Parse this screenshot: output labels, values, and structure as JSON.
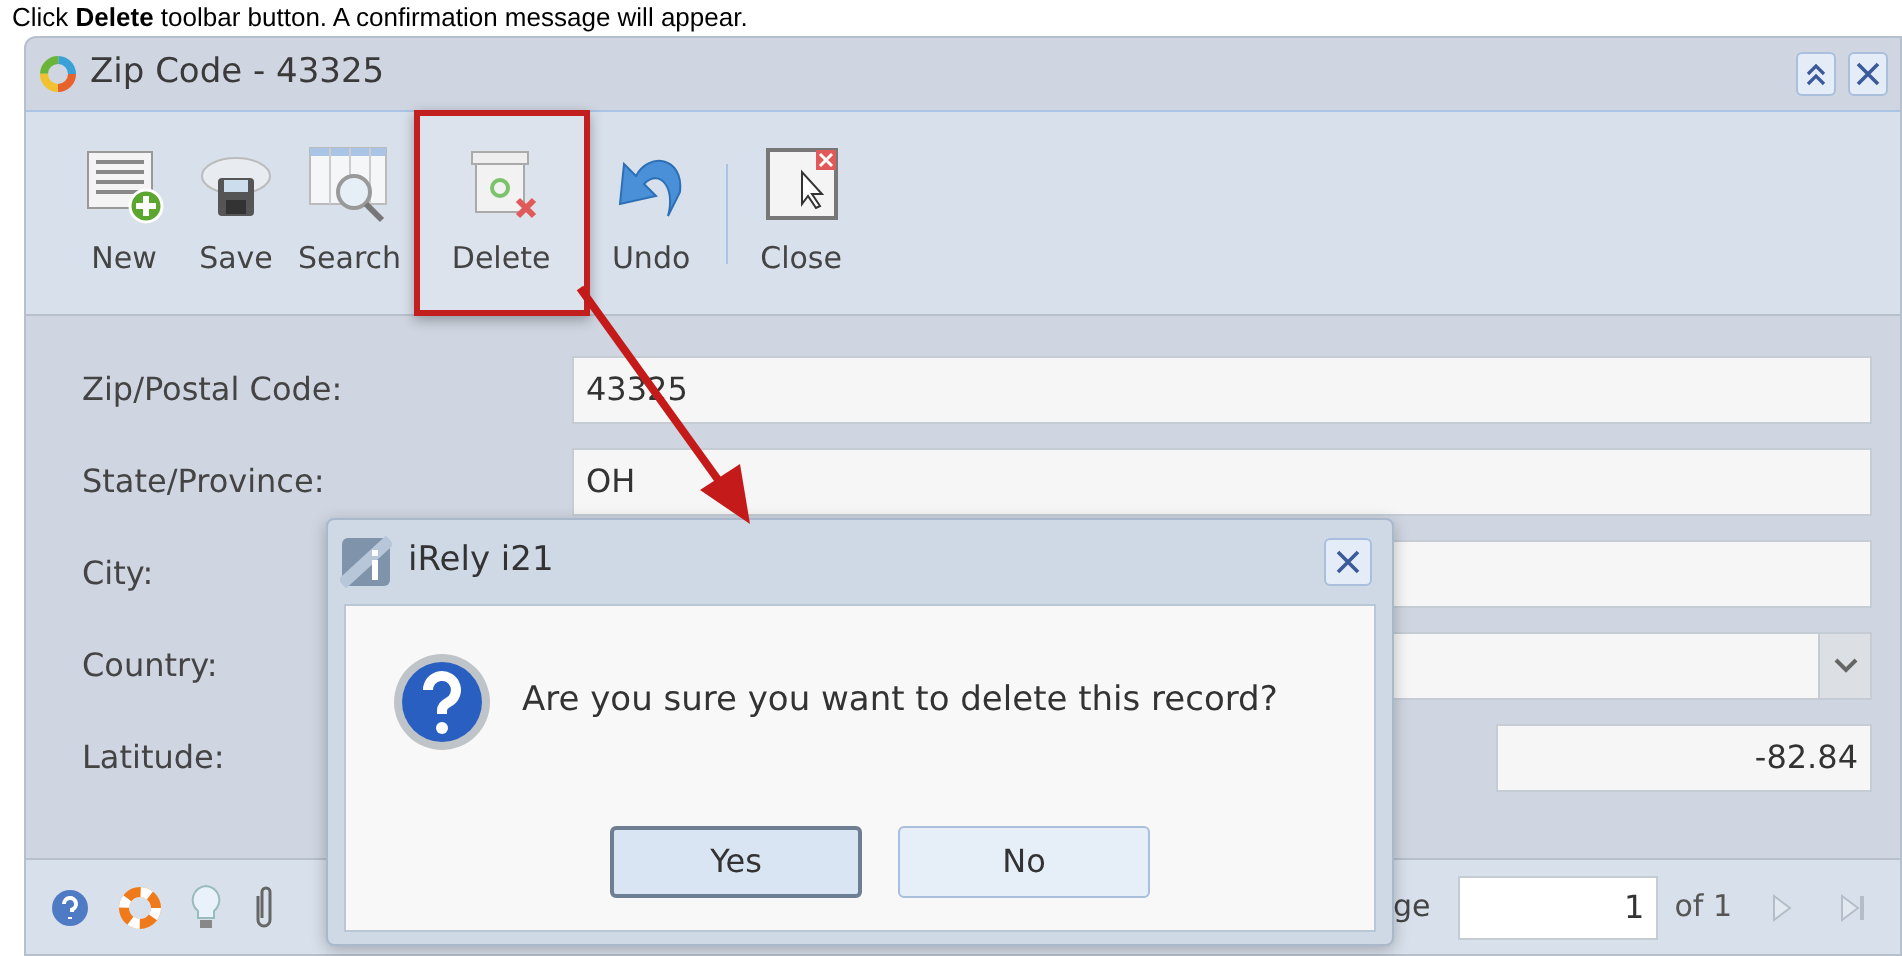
{
  "caption": "Click **Delete** toolbar button. A confirmation message will appear.",
  "window": {
    "title": "Zip Code - 43325"
  },
  "toolbar": [
    {
      "label": "New",
      "kind": "new",
      "highlighted": false
    },
    {
      "label": "Save",
      "kind": "save",
      "highlighted": false
    },
    {
      "label": "Search",
      "kind": "search",
      "highlighted": false
    },
    {
      "label": "Delete",
      "kind": "delete",
      "highlighted": true
    },
    {
      "label": "Undo",
      "kind": "undo",
      "highlighted": false
    },
    {
      "label": "Close",
      "kind": "close",
      "highlighted": false
    }
  ],
  "form": [
    {
      "label": "Zip/Postal Code:",
      "value": "43325",
      "kind": "text"
    },
    {
      "label": "State/Province:",
      "value": "OH",
      "kind": "text"
    },
    {
      "label": "City:",
      "kind": "text"
    },
    {
      "label": "Country:",
      "kind": "combo"
    },
    {
      "label": "Latitude:",
      "value": "-82.84",
      "kind": "number"
    }
  ],
  "paging": {
    "label": "ge",
    "page": "1",
    "total": "of 1"
  },
  "dialog": {
    "title": "iRely i21",
    "message": "Are you sure you want to delete this record?",
    "buttons": [
      {
        "label": "Yes",
        "selected": true
      },
      {
        "label": "No",
        "selected": false
      }
    ]
  }
}
